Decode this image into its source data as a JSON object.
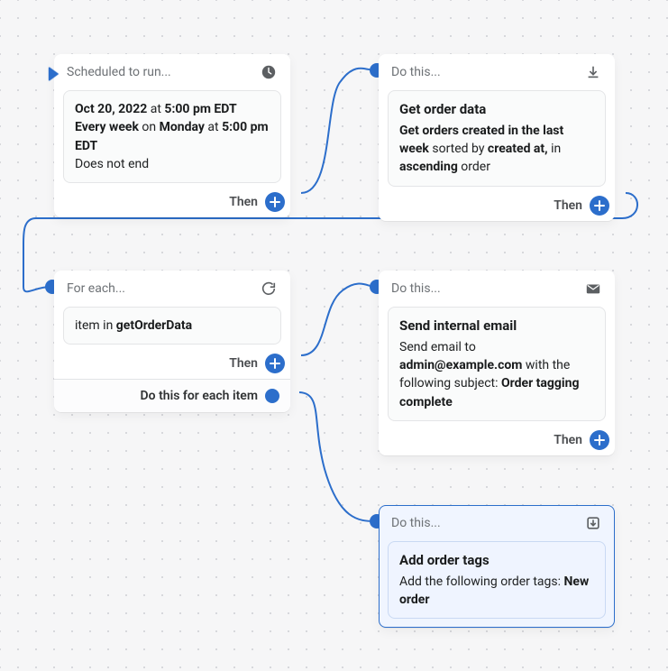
{
  "nodes": {
    "schedule": {
      "header": "Scheduled to run...",
      "line1_pre": "",
      "date": "Oct 20, 2022",
      "at1": " at ",
      "time1": "5:00 pm EDT",
      "line2_pre": "",
      "freq": "Every week",
      "on": " on ",
      "day": "Monday",
      "at2": " at ",
      "time2": "5:00 pm EDT",
      "line3": "Does not end",
      "then": "Then"
    },
    "getorder": {
      "header": "Do this...",
      "title": "Get order data",
      "p1a": "Get orders created in the last week",
      "p1b": " sorted by ",
      "p1c": "created at,",
      "p1d": " in ",
      "p2a": "ascending",
      "p2b": " order",
      "then": "Then"
    },
    "foreach": {
      "header": "For each...",
      "item_pre": "item in ",
      "item_src": "getOrderData",
      "then": "Then",
      "footer": "Do this for each item"
    },
    "email": {
      "header": "Do this...",
      "title": "Send internal email",
      "l1": "Send email to ",
      "addr": "admin@example.com",
      "l2": " with the following subject: ",
      "subj": "Order tagging complete",
      "then": "Then"
    },
    "addtags": {
      "header": "Do this...",
      "title": "Add order tags",
      "l1": "Add the following order tags: ",
      "tag": "New order"
    }
  }
}
